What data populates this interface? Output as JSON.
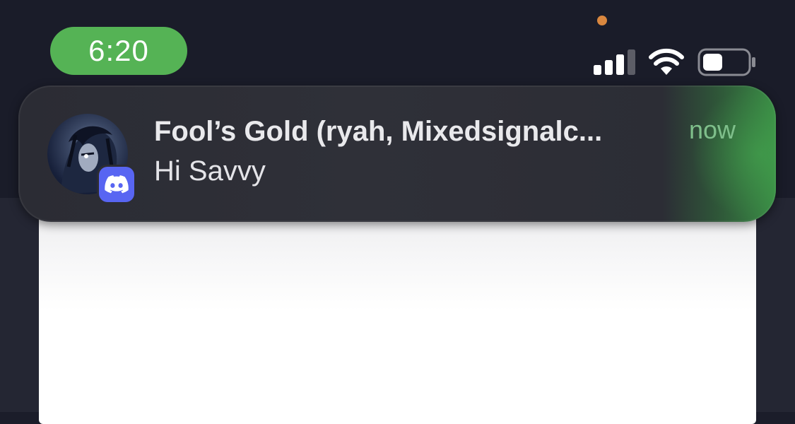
{
  "status_bar": {
    "time": "6:20",
    "time_pill_color": "#55b355",
    "privacy_indicator_color": "#d9873f",
    "signal_icon": "cellular-signal-icon",
    "wifi_icon": "wifi-icon",
    "battery_icon": "battery-icon",
    "battery_level": 0.45
  },
  "notification": {
    "app_icon": "discord-icon",
    "app_color": "#5865f2",
    "avatar_icon": "avatar-image",
    "title": "Fool’s Gold (ryah, Mixedsignalc...",
    "message": "Hi Savvy",
    "time": "now"
  }
}
